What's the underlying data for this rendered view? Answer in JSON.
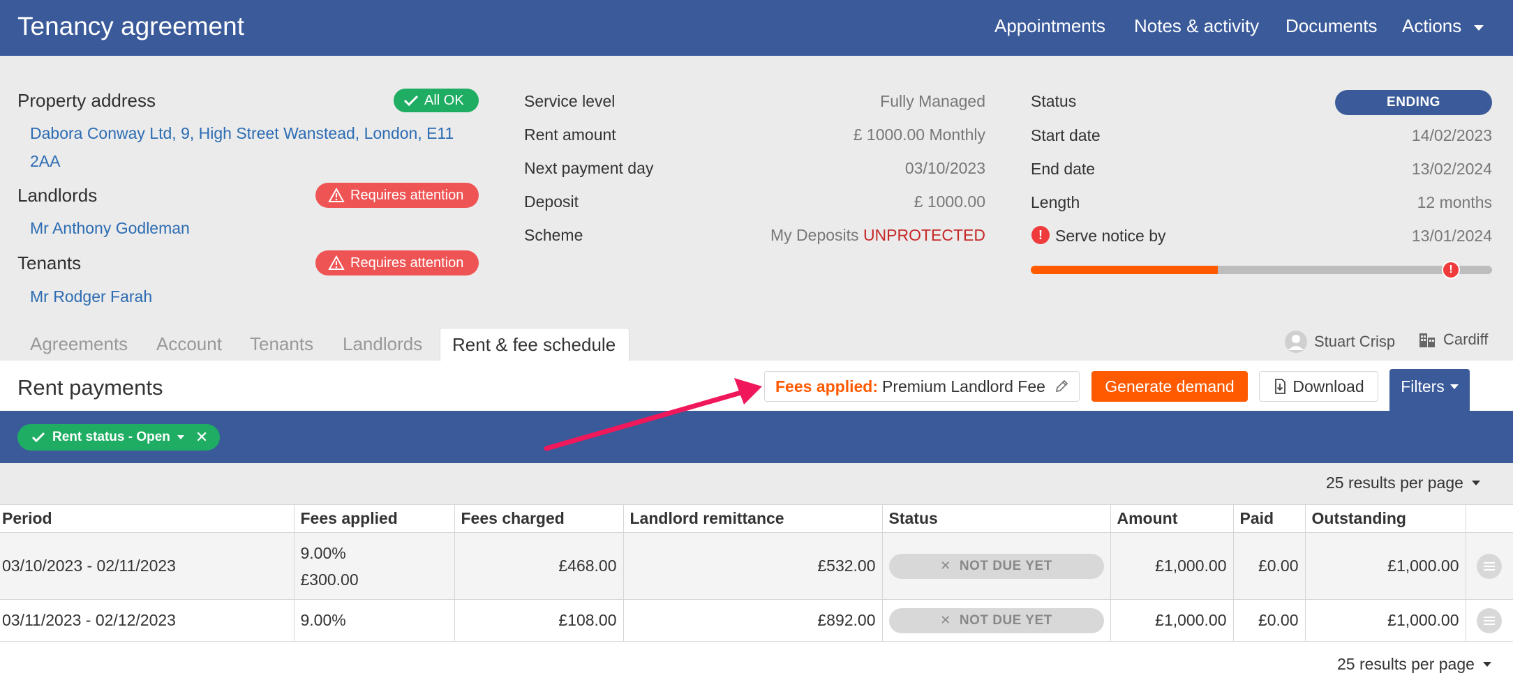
{
  "header": {
    "title": "Tenancy agreement",
    "nav": [
      "Appointments",
      "Notes & activity",
      "Documents",
      "Actions"
    ]
  },
  "property": {
    "address_label": "Property address",
    "address_status": "All OK",
    "address_line1": "Dabora Conway Ltd, 9, High Street Wanstead, London, E11",
    "address_line2": "2AA",
    "landlords_label": "Landlords",
    "landlords_status": "Requires attention",
    "landlord_name": "Mr Anthony Godleman",
    "tenants_label": "Tenants",
    "tenants_status": "Requires attention",
    "tenant_name": "Mr Rodger Farah"
  },
  "financials": {
    "service_level_label": "Service level",
    "service_level": "Fully Managed",
    "rent_amount_label": "Rent amount",
    "rent_amount": "£ 1000.00 Monthly",
    "next_payment_label": "Next payment day",
    "next_payment": "03/10/2023",
    "deposit_label": "Deposit",
    "deposit": "£ 1000.00",
    "scheme_label": "Scheme",
    "scheme": "My Deposits",
    "scheme_status": "UNPROTECTED"
  },
  "tenancy": {
    "status_label": "Status",
    "status": "ENDING",
    "start_label": "Start date",
    "start": "14/02/2023",
    "end_label": "End date",
    "end": "13/02/2024",
    "length_label": "Length",
    "length": "12 months",
    "notice_label": "Serve notice by",
    "notice": "13/01/2024",
    "progress_fraction": 0.405,
    "progress_color": "#ff5a00"
  },
  "tabs": [
    "Agreements",
    "Account",
    "Tenants",
    "Landlords",
    "Rent & fee schedule"
  ],
  "meta": {
    "user": "Stuart Crisp",
    "branch": "Cardiff"
  },
  "toolbar": {
    "section_title": "Rent payments",
    "fees_label": "Fees applied:",
    "fees_value": "Premium Landlord Fee",
    "generate_label": "Generate demand",
    "download_label": "Download",
    "filters_label": "Filters"
  },
  "filter_chip": "Rent status - Open",
  "pager": "25 results per page",
  "table": {
    "columns": [
      "Period",
      "Fees applied",
      "Fees charged",
      "Landlord remittance",
      "Status",
      "Amount",
      "Paid",
      "Outstanding"
    ],
    "rows": [
      {
        "period": "03/10/2023 - 02/11/2023",
        "fees_line1": "9.00%",
        "fees_line2": "£300.00",
        "fees_charged": "£468.00",
        "remittance": "£532.00",
        "status": "NOT DUE YET",
        "amount": "£1,000.00",
        "paid": "£0.00",
        "outstanding": "£1,000.00"
      },
      {
        "period": "03/11/2023 - 02/12/2023",
        "fees_line1": "9.00%",
        "fees_line2": "",
        "fees_charged": "£108.00",
        "remittance": "£892.00",
        "status": "NOT DUE YET",
        "amount": "£1,000.00",
        "paid": "£0.00",
        "outstanding": "£1,000.00"
      }
    ]
  },
  "colors": {
    "brand": "#3a5a9a",
    "accent": "#ff5a00",
    "ok": "#1fad63",
    "warn": "#ef5454",
    "annotation_arrow": "#f0185a"
  }
}
